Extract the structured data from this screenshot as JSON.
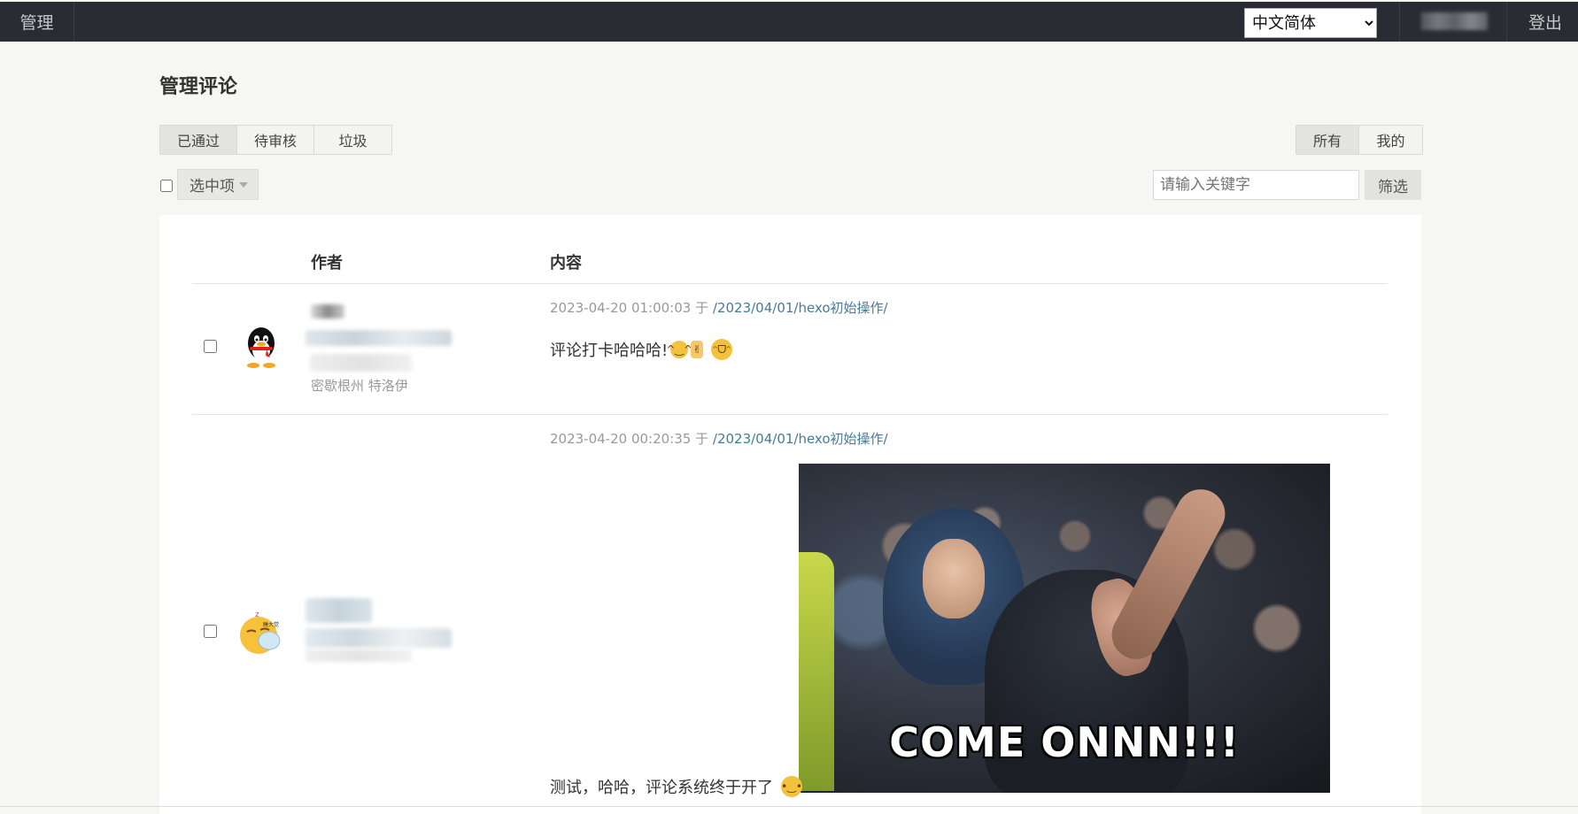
{
  "topbar": {
    "manage_label": "管理",
    "language_selected": "中文简体",
    "logout_label": "登出"
  },
  "page": {
    "title": "管理评论"
  },
  "status_tabs": [
    {
      "label": "已通过",
      "active": true
    },
    {
      "label": "待审核",
      "active": false
    },
    {
      "label": "垃圾",
      "active": false
    }
  ],
  "scope_tabs": [
    {
      "label": "所有",
      "active": true
    },
    {
      "label": "我的",
      "active": false
    }
  ],
  "actions": {
    "select_label": "选中项",
    "search_placeholder": "请输入关键字",
    "filter_label": "筛选"
  },
  "table": {
    "headers": {
      "author": "作者",
      "content": "内容"
    },
    "rows": [
      {
        "avatar_icon": "qq-penguin-icon",
        "location": "密歇根州 特洛伊",
        "date": "2023-04-20 01:00:03",
        "on_word": "于",
        "path": "/2023/04/01/hexo初始操作/",
        "text": "评论打卡哈哈哈!",
        "emojis": [
          "smile-emoji-icon",
          "victory-hand-emoji-icon",
          "grin-emoji-icon"
        ]
      },
      {
        "avatar_icon": "sleepy-emoji-icon",
        "location": "",
        "date": "2023-04-20 00:20:35",
        "on_word": "于",
        "path": "/2023/04/01/hexo初始操作/",
        "text": "测试，哈哈，评论系统终于开了",
        "emojis": [
          "slight-smile-emoji-icon"
        ],
        "image_caption": "COME ONNN!!!"
      }
    ]
  },
  "colors": {
    "topbar_bg": "#292d33",
    "page_bg": "#f6f6f3",
    "link": "#467b96",
    "meta_text": "#999999"
  }
}
